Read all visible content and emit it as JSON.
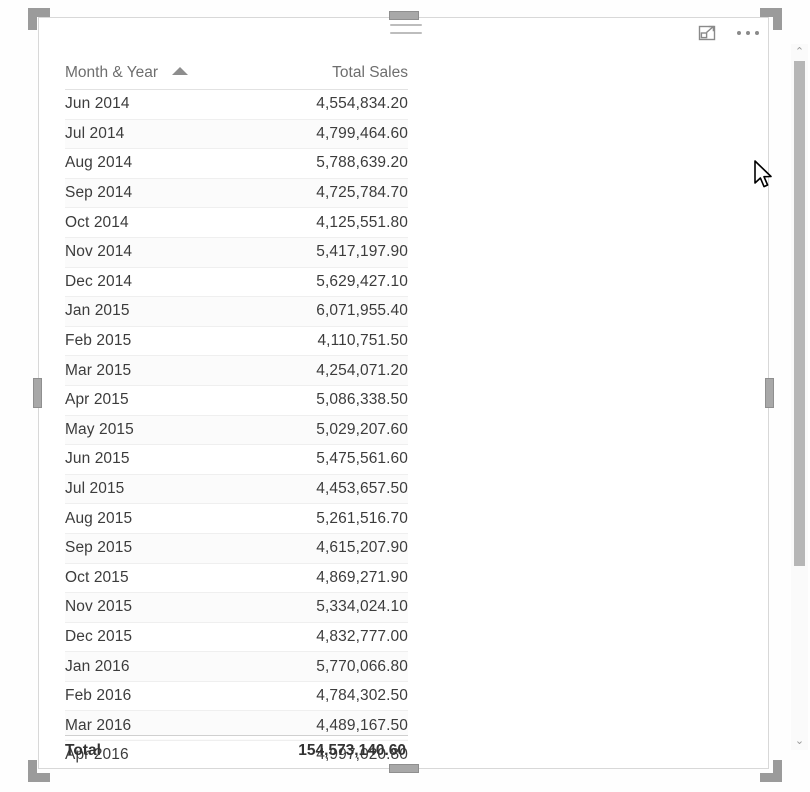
{
  "visual": {
    "type": "table-visual",
    "header": {
      "drag_grip": "drag-grip-icon",
      "focus_mode_label": "focus-mode-icon",
      "more_options_label": "more-options-icon"
    }
  },
  "table": {
    "columns": [
      {
        "key": "month",
        "label": "Month & Year",
        "align": "left",
        "sort": "ascending"
      },
      {
        "key": "sales",
        "label": "Total Sales",
        "align": "right",
        "sort": "none"
      }
    ],
    "rows": [
      {
        "month": "Jun 2014",
        "sales": "4,554,834.20"
      },
      {
        "month": "Jul 2014",
        "sales": "4,799,464.60"
      },
      {
        "month": "Aug 2014",
        "sales": "5,788,639.20"
      },
      {
        "month": "Sep 2014",
        "sales": "4,725,784.70"
      },
      {
        "month": "Oct 2014",
        "sales": "4,125,551.80"
      },
      {
        "month": "Nov 2014",
        "sales": "5,417,197.90"
      },
      {
        "month": "Dec 2014",
        "sales": "5,629,427.10"
      },
      {
        "month": "Jan 2015",
        "sales": "6,071,955.40"
      },
      {
        "month": "Feb 2015",
        "sales": "4,110,751.50"
      },
      {
        "month": "Mar 2015",
        "sales": "4,254,071.20"
      },
      {
        "month": "Apr 2015",
        "sales": "5,086,338.50"
      },
      {
        "month": "May 2015",
        "sales": "5,029,207.60"
      },
      {
        "month": "Jun 2015",
        "sales": "5,475,561.60"
      },
      {
        "month": "Jul 2015",
        "sales": "4,453,657.50"
      },
      {
        "month": "Aug 2015",
        "sales": "5,261,516.70"
      },
      {
        "month": "Sep 2015",
        "sales": "4,615,207.90"
      },
      {
        "month": "Oct 2015",
        "sales": "4,869,271.90"
      },
      {
        "month": "Nov 2015",
        "sales": "5,334,024.10"
      },
      {
        "month": "Dec 2015",
        "sales": "4,832,777.00"
      },
      {
        "month": "Jan 2016",
        "sales": "5,770,066.80"
      },
      {
        "month": "Feb 2016",
        "sales": "4,784,302.50"
      },
      {
        "month": "Mar 2016",
        "sales": "4,489,167.50"
      },
      {
        "month": "Apr 2016",
        "sales": "4,997,020.80"
      }
    ],
    "total": {
      "label": "Total",
      "value": "154,573,140.60"
    }
  },
  "scrollbar": {
    "up_arrow": "⌃",
    "down_arrow": "⌄",
    "orientation": "vertical"
  },
  "colors": {
    "header_text": "#6e6e6e",
    "cell_text": "#3c3c3c",
    "total_text": "#333333",
    "row_separator": "#efefef",
    "alt_row_background": "#fbfbfb",
    "scrollbar_thumb": "#b6b6b6",
    "handle": "#9b9b9b",
    "frame_border": "#d8d8d8"
  }
}
